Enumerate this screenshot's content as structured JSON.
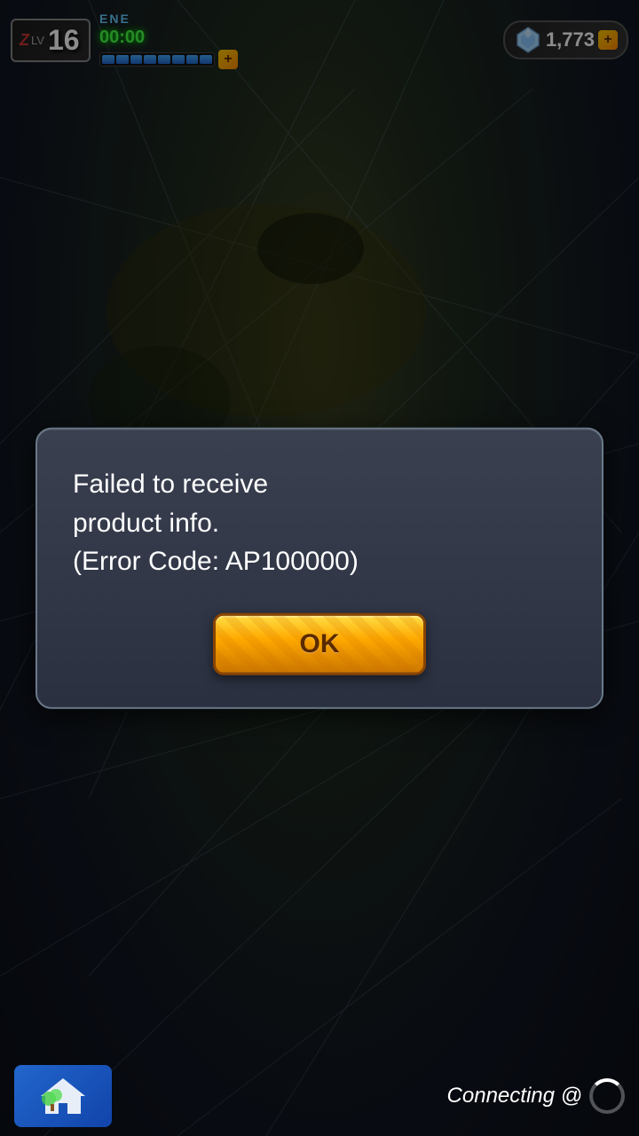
{
  "hud": {
    "level_z": "Z",
    "level_lv": "LV",
    "level_num": "16",
    "energy_label": "ENE",
    "timer": "00:00",
    "energy_segments": 8,
    "currency_amount": "1,773",
    "plus_symbol": "+"
  },
  "dialog": {
    "message": "Failed to receive\nproduct info.\n(Error Code: AP100000)",
    "ok_label": "OK"
  },
  "bottom": {
    "connecting_text": "Connecting @",
    "spinner_visible": true
  }
}
